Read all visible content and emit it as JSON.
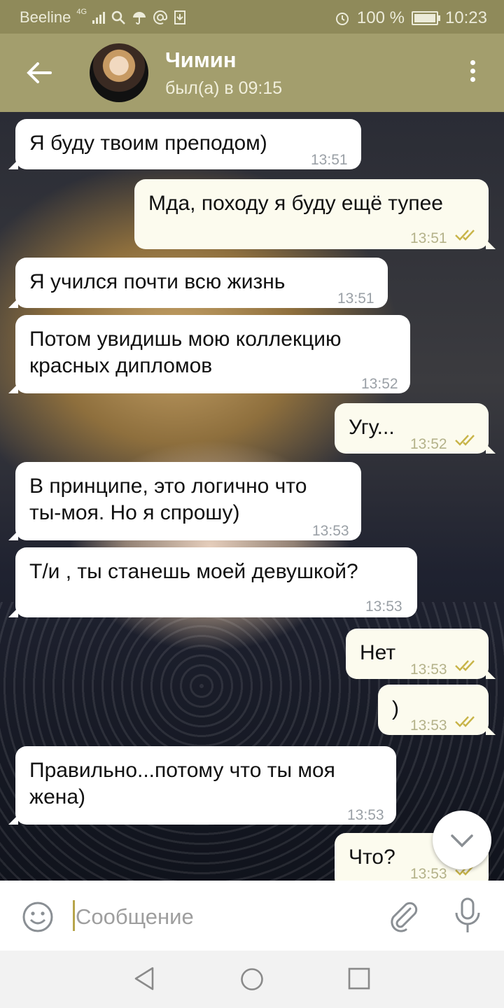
{
  "status_bar": {
    "carrier": "Beeline",
    "network": "4G",
    "battery": "100 %",
    "battery_level": 1.0,
    "time": "10:23",
    "icons": [
      "signal-icon",
      "search-icon",
      "umbrella-icon",
      "at-icon",
      "download-icon",
      "alarm-icon",
      "battery-icon"
    ]
  },
  "header": {
    "contact_name": "Чимин",
    "last_seen": "был(а) в 09:15",
    "icons": [
      "back-arrow-icon",
      "avatar",
      "more-vert-icon"
    ]
  },
  "messages": [
    {
      "dir": "in",
      "text": "Я буду твоим преподом)",
      "time": "13:51"
    },
    {
      "dir": "out",
      "text": "Мда, походу я буду ещё тупее",
      "time": "13:51",
      "read": true
    },
    {
      "dir": "in",
      "text": "Я учился почти всю жизнь",
      "time": "13:51"
    },
    {
      "dir": "in",
      "text": "Потом увидишь мою коллекцию\nкрасных дипломов",
      "time": "13:52"
    },
    {
      "dir": "out",
      "text": "Угу...",
      "time": "13:52",
      "read": true
    },
    {
      "dir": "in",
      "text": "В принципе, это логично что\nты-моя. Но я спрошу)",
      "time": "13:53"
    },
    {
      "dir": "in",
      "text": "Т/и , ты станешь моей девушкой?",
      "time": "13:53"
    },
    {
      "dir": "out",
      "text": "Нет",
      "time": "13:53",
      "read": true
    },
    {
      "dir": "out",
      "text": ")",
      "time": "13:53",
      "read": true
    },
    {
      "dir": "in",
      "text": "Правильно...потому что ты моя\nжена)",
      "time": "13:53"
    },
    {
      "dir": "out",
      "text": "Что?",
      "time": "13:53",
      "read": true
    }
  ],
  "input": {
    "placeholder": "Сообщение",
    "value": ""
  },
  "colors": {
    "header": "#a39e6d",
    "status_bar": "#8f8a5a",
    "incoming_bubble": "#ffffff",
    "outgoing_bubble": "#fcfbee",
    "read_check": "#c8b448",
    "cursor": "#b7a54a"
  },
  "nav_bar": {
    "icons": [
      "nav-back-icon",
      "nav-home-icon",
      "nav-recents-icon"
    ]
  }
}
